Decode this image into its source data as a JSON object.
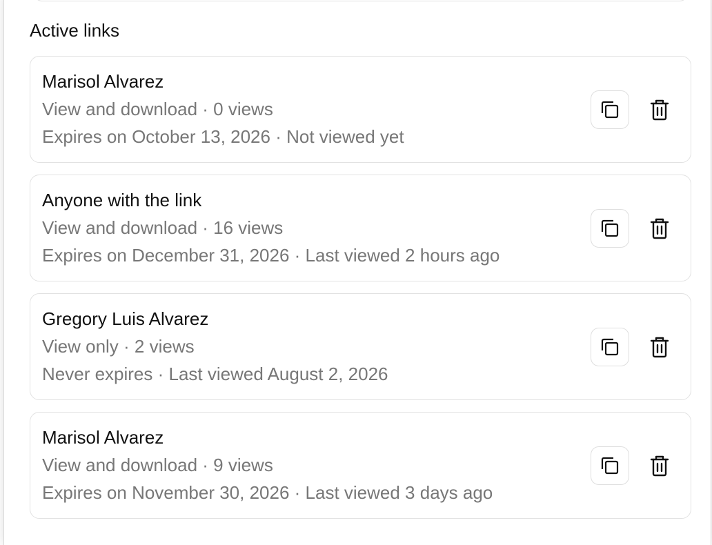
{
  "section": {
    "title": "Active links"
  },
  "links": [
    {
      "name": "Marisol Alvarez",
      "access": "View and download · 0 views",
      "expiry": "Expires on October 13, 2026 · Not viewed yet",
      "actions": {
        "copy_icon": "copy-icon",
        "delete_icon": "trash-icon"
      }
    },
    {
      "name": "Anyone with the link",
      "access": "View and download · 16 views",
      "expiry": "Expires on December 31, 2026 · Last viewed 2 hours ago",
      "actions": {
        "copy_icon": "copy-icon",
        "delete_icon": "trash-icon"
      }
    },
    {
      "name": "Gregory Luis Alvarez",
      "access": "View only · 2 views",
      "expiry": "Never expires · Last viewed August 2, 2026",
      "actions": {
        "copy_icon": "copy-icon",
        "delete_icon": "trash-icon"
      }
    },
    {
      "name": "Marisol Alvarez",
      "access": "View and download · 9 views",
      "expiry": "Expires on November 30, 2026 · Last viewed 3 days ago",
      "actions": {
        "copy_icon": "copy-icon",
        "delete_icon": "trash-icon"
      }
    }
  ],
  "colors": {
    "primary_text": "#111111",
    "secondary_text": "#777777",
    "card_border": "#e2e2e2",
    "background": "#ffffff"
  }
}
